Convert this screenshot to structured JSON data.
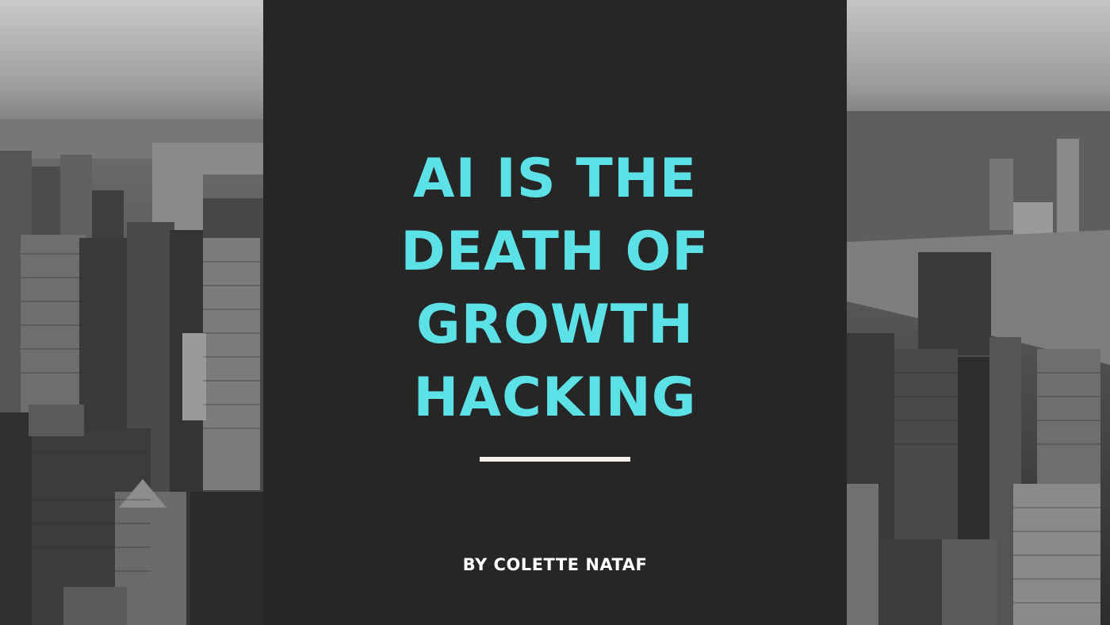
{
  "title": {
    "lines": [
      "AI IS THE",
      "DEATH OF",
      "GROWTH",
      "HACKING"
    ]
  },
  "byline": "BY COLETTE NATAF",
  "colors": {
    "accent": "#5ce1e6",
    "panel": "#262626",
    "divider": "#f4f1ea",
    "byline": "#ffffff"
  }
}
